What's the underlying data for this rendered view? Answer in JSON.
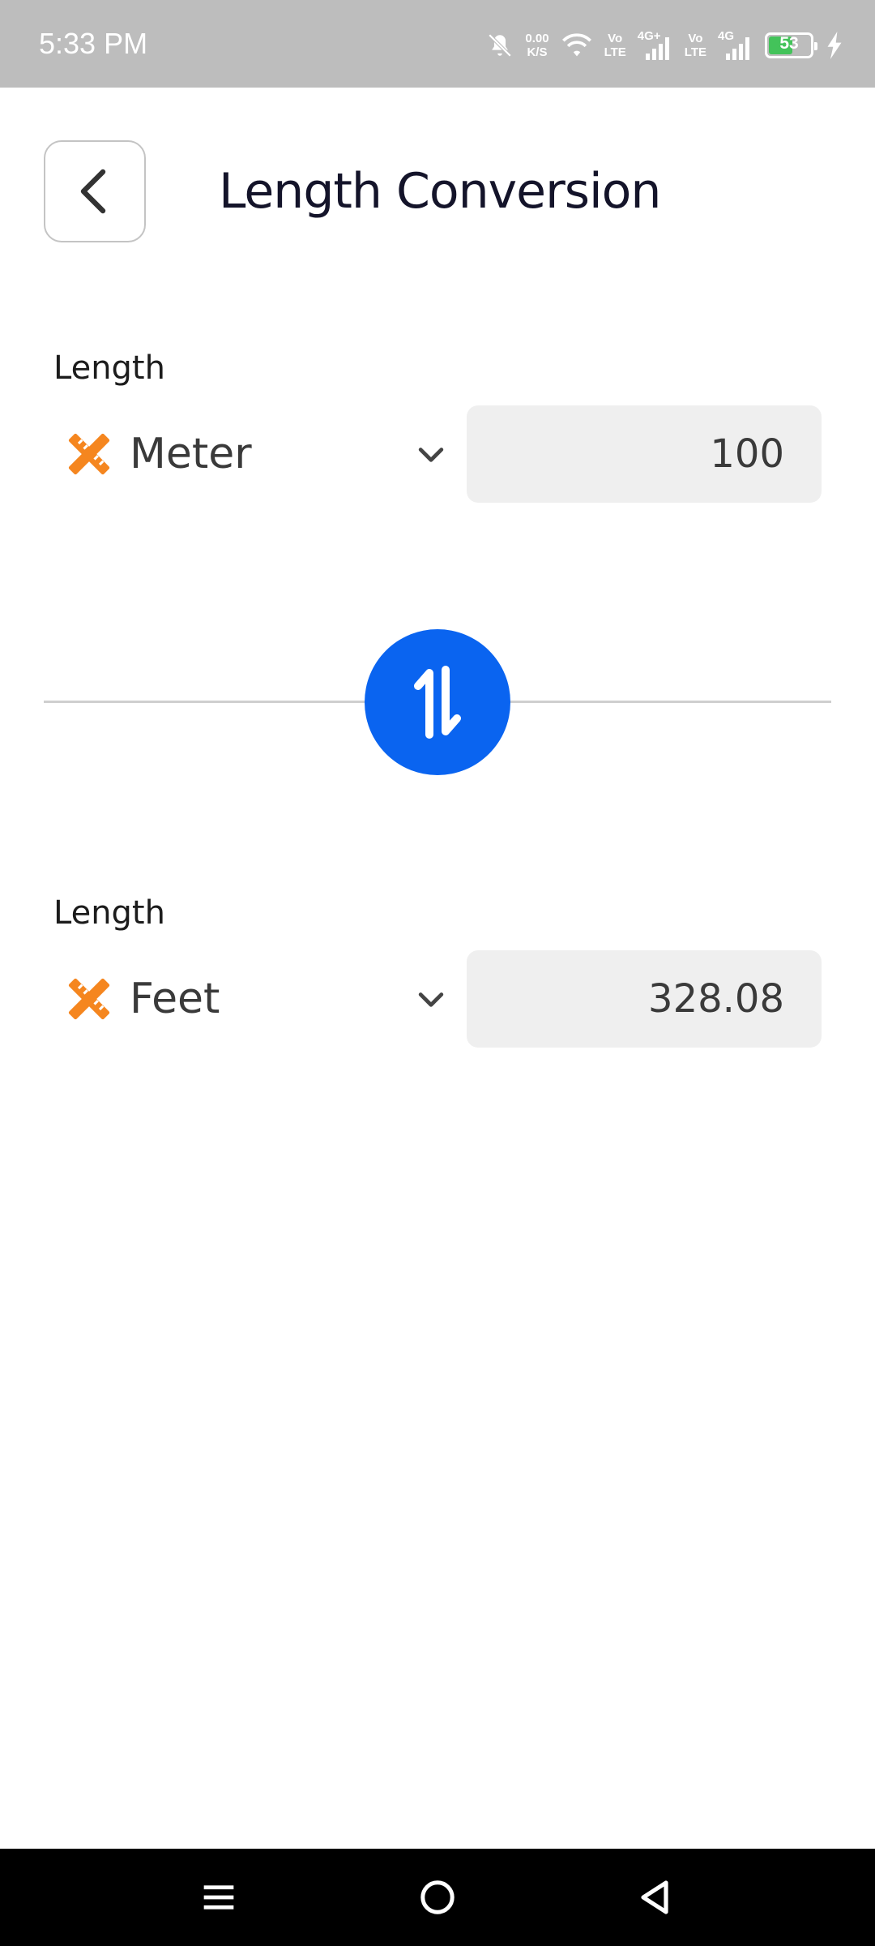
{
  "status_bar": {
    "time": "5:33 PM",
    "net_speed_value": "0.00",
    "net_speed_unit": "K/S",
    "sim1_tag_top": "Vo",
    "sim1_tag_bottom": "LTE",
    "sim1_network": "4G+",
    "sim2_tag_top": "Vo",
    "sim2_tag_bottom": "LTE",
    "sim2_network": "4G",
    "battery_level": "53",
    "icons": [
      "mute-bell-icon",
      "wifi-icon",
      "signal-icon",
      "signal-icon",
      "battery-icon",
      "charging-bolt-icon"
    ]
  },
  "header": {
    "back_icon": "chevron-left-icon",
    "title": "Length Conversion"
  },
  "from": {
    "label": "Length",
    "unit_icon": "ruler-pencil-icon",
    "unit": "Meter",
    "value": "100"
  },
  "swap": {
    "icon": "swap-vertical-arrows-icon"
  },
  "to": {
    "label": "Length",
    "unit_icon": "ruler-pencil-icon",
    "unit": "Feet",
    "value": "328.08"
  },
  "nav_bar": {
    "icons": [
      "menu-icon",
      "home-circle-icon",
      "back-triangle-icon"
    ]
  },
  "colors": {
    "accent": "#0a64f0",
    "unit_icon": "#f5861f",
    "status_bar": "#bdbdbd",
    "battery": "#43c35a",
    "value_box": "#efefef"
  }
}
